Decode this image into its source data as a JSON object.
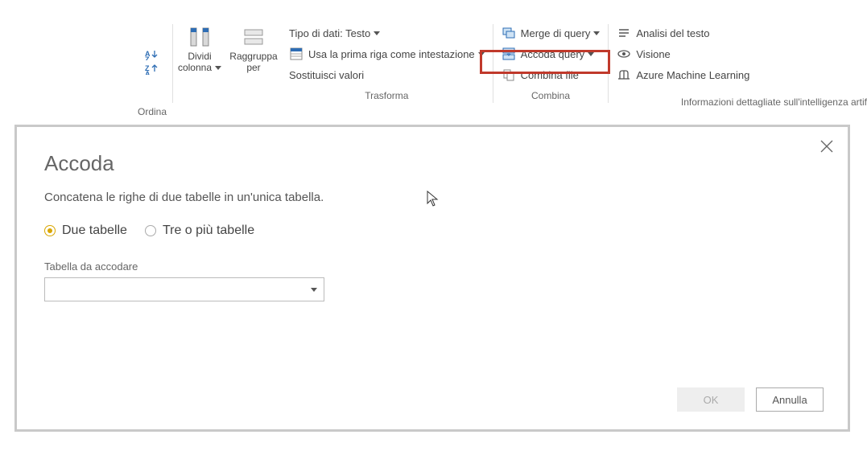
{
  "ribbon": {
    "ordina": {
      "label": "Ordina"
    },
    "dividi_colonna": {
      "label1": "Dividi",
      "label2": "colonna"
    },
    "raggruppa": {
      "label1": "Raggruppa",
      "label2": "per"
    },
    "tipo_dati": "Tipo di dati: Testo",
    "prima_riga": "Usa la prima riga come intestazione",
    "sostituisci": "Sostituisci valori",
    "trasforma_label": "Trasforma",
    "merge_query": "Merge di query",
    "accoda_query": "Accoda query",
    "combina_file": "Combina file",
    "combina_label": "Combina",
    "analisi_testo": "Analisi del testo",
    "visione": "Visione",
    "azure_ml": "Azure Machine Learning",
    "ai_label": "Informazioni dettagliate sull'intelligenza artif"
  },
  "dialog": {
    "title": "Accoda",
    "description": "Concatena le righe di due tabelle in un'unica tabella.",
    "radio_two": "Due tabelle",
    "radio_three": "Tre o più tabelle",
    "field_label": "Tabella da accodare",
    "combo_value": "",
    "btn_ok": "OK",
    "btn_cancel": "Annulla"
  }
}
